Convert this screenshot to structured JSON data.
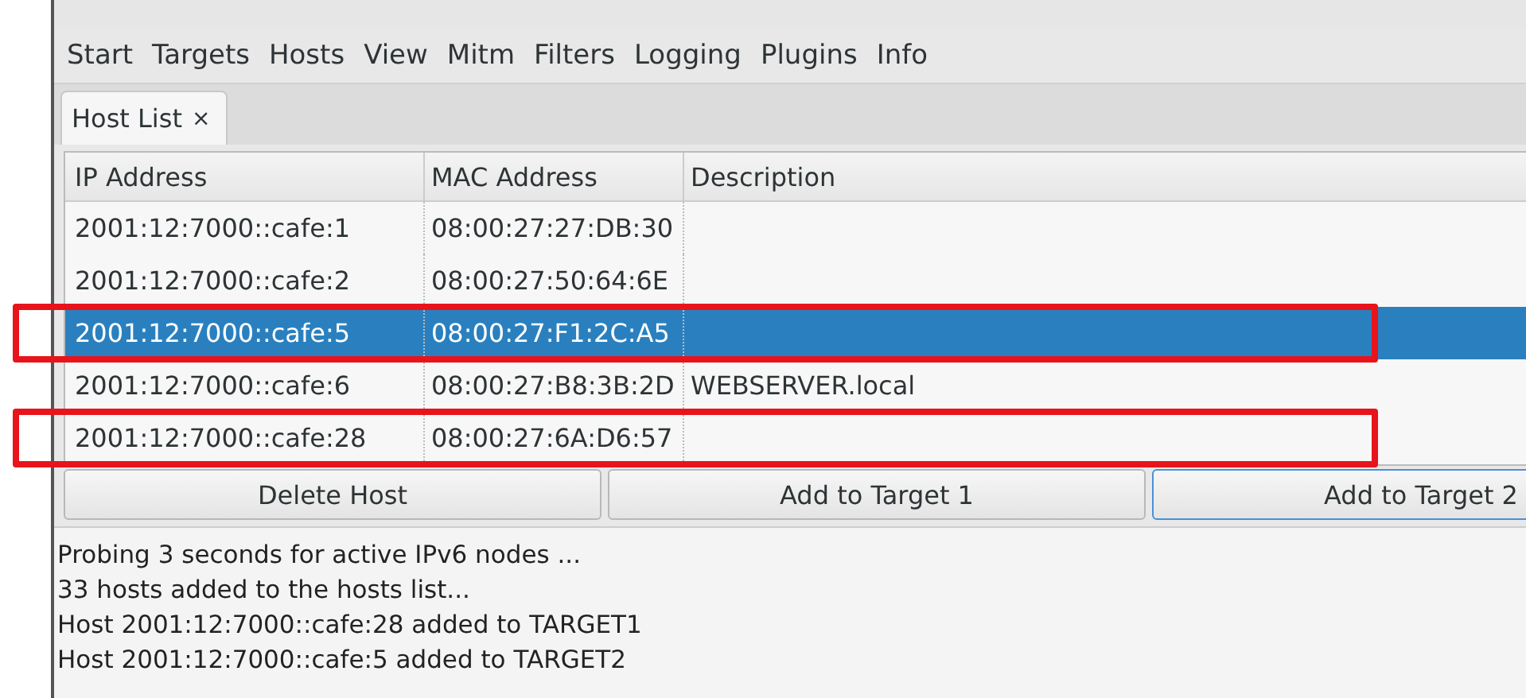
{
  "menu": [
    "Start",
    "Targets",
    "Hosts",
    "View",
    "Mitm",
    "Filters",
    "Logging",
    "Plugins",
    "Info"
  ],
  "tabs": [
    {
      "label": "Host List",
      "close": "×",
      "selected": true
    }
  ],
  "table": {
    "columns": [
      "IP Address",
      "MAC Address",
      "Description"
    ],
    "rows": [
      {
        "ip": "2001:12:7000::cafe:1",
        "mac": "08:00:27:27:DB:30",
        "selected": false,
        "highlighted": false
      },
      {
        "ip": "2001:12:7000::cafe:2",
        "mac": "08:00:27:50:64:6E",
        "selected": false,
        "highlighted": false
      },
      {
        "ip": "2001:12:7000::cafe:5",
        "mac": "08:00:27:F1:2C:A5",
        "selected": true,
        "highlighted": true
      },
      {
        "ip": "2001:12:7000::cafe:6",
        "mac": "08:00:27:B8:3B:2D",
        "description": "WEBSERVER.local",
        "selected": false,
        "highlighted": false
      },
      {
        "ip": "2001:12:7000::cafe:28",
        "mac": "08:00:27:6A:D6:57",
        "selected": false,
        "highlighted": true
      }
    ]
  },
  "buttons": [
    {
      "label": "Delete Host",
      "focused": false
    },
    {
      "label": "Add to Target 1",
      "focused": false
    },
    {
      "label": "Add to Target 2",
      "focused": true
    }
  ],
  "log": [
    "Probing 3 seconds for active IPv6 nodes ...",
    "33 hosts added to the hosts list...",
    "Host 2001:12:7000::cafe:28 added to TARGET1",
    "Host 2001:12:7000::cafe:5 added to TARGET2"
  ]
}
